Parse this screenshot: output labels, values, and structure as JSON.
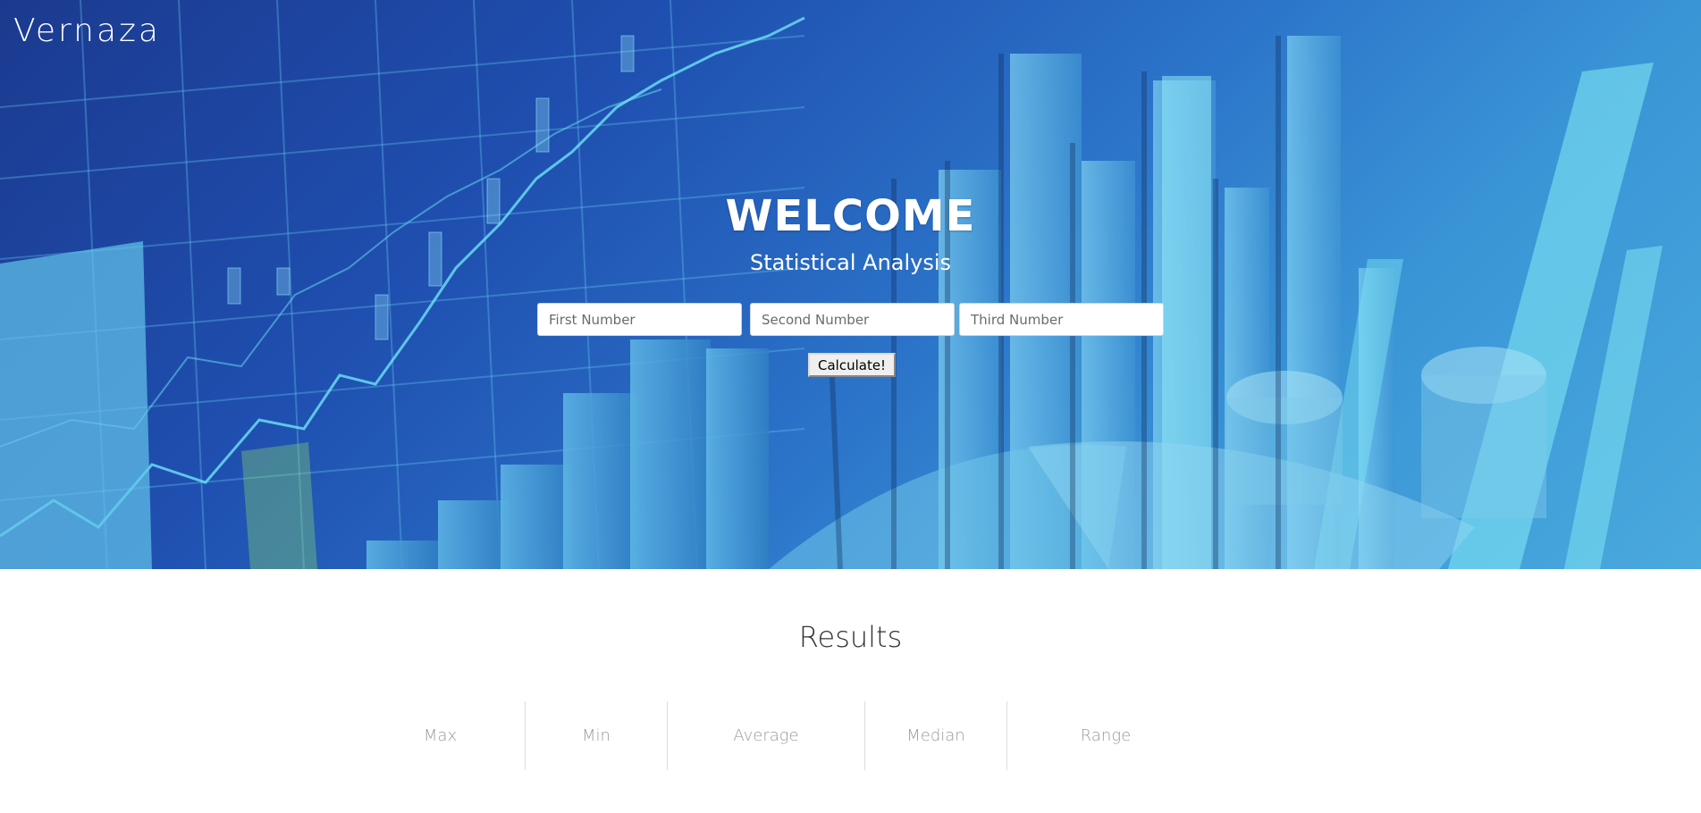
{
  "brand": "Vernaza",
  "hero": {
    "title": "WELCOME",
    "subtitle": "Statistical Analysis"
  },
  "form": {
    "first_placeholder": "First Number",
    "second_placeholder": "Second Number",
    "third_placeholder": "Third Number",
    "calculate_label": "Calculate!"
  },
  "results": {
    "title": "Results",
    "columns": [
      "Max",
      "Min",
      "Average",
      "Median",
      "Range"
    ]
  },
  "colors": {
    "hero_dark": "#1b3a8f",
    "hero_light": "#4aa9dd",
    "text_light": "#ffffff",
    "stat_label": "#9a9a9a"
  }
}
